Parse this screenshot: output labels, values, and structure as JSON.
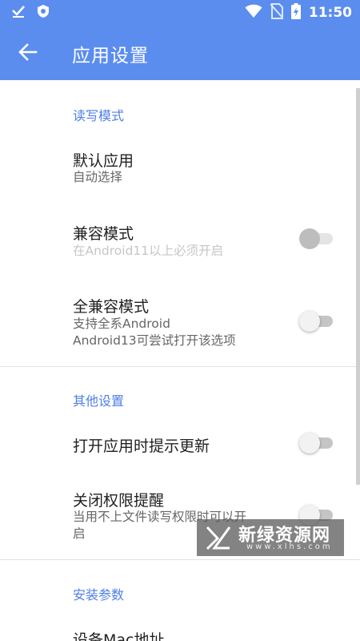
{
  "status_bar": {
    "time": "11:50",
    "icons": [
      "download-done-icon",
      "shield-icon",
      "wifi-icon",
      "no-sim-icon",
      "battery-charging-icon"
    ]
  },
  "app_bar": {
    "title": "应用设置",
    "back_icon": "arrow-left-icon"
  },
  "sections": [
    {
      "header": "读写模式",
      "items": [
        {
          "title": "默认应用",
          "subtitle": "自动选择"
        },
        {
          "title": "兼容模式",
          "subtitle": "在Android11以上必须开启",
          "toggle": "off",
          "disabled": true
        },
        {
          "title": "全兼容模式",
          "subtitle_lines": [
            "支持全系Android",
            "Android13可尝试打开该选项"
          ],
          "toggle": "off"
        }
      ]
    },
    {
      "header": "其他设置",
      "items": [
        {
          "title": "打开应用时提示更新",
          "toggle": "off"
        },
        {
          "title": "关闭权限提醒",
          "subtitle_lines": [
            "当用不上文件读写权限时可以开",
            "启"
          ],
          "toggle": "off"
        }
      ]
    },
    {
      "header": "安装参数",
      "items": [
        {
          "title": "设备Mac地址"
        }
      ]
    }
  ],
  "watermark": {
    "title": "新绿资源网",
    "subtitle": "www.xlhs.com"
  },
  "colors": {
    "primary": "#5b8def",
    "section_header": "#4f7fe6",
    "text_primary": "#212121",
    "text_secondary": "#666666",
    "text_disabled": "#c6c6c6"
  }
}
